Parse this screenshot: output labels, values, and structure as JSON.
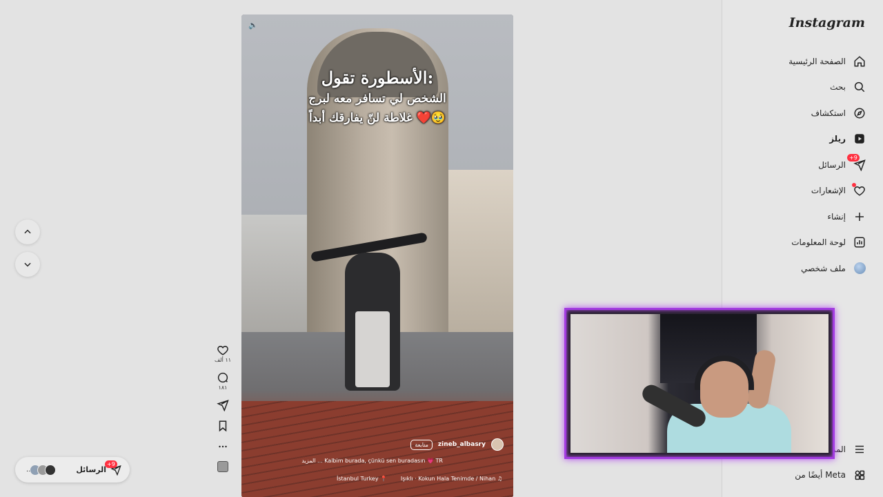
{
  "sidebar": {
    "logo": "Instagram",
    "items": [
      {
        "label": "الصفحة الرئيسية",
        "icon": "home-icon"
      },
      {
        "label": "بحث",
        "icon": "search-icon"
      },
      {
        "label": "استكشاف",
        "icon": "compass-icon"
      },
      {
        "label": "ريلز",
        "icon": "reels-icon"
      },
      {
        "label": "الرسائل",
        "icon": "messenger-icon",
        "badge": "+9"
      },
      {
        "label": "الإشعارات",
        "icon": "heart-icon"
      },
      {
        "label": "إنشاء",
        "icon": "plus-icon"
      },
      {
        "label": "لوحة المعلومات",
        "icon": "dashboard-icon"
      },
      {
        "label": "ملف شخصي",
        "icon": "profile-avatar"
      }
    ],
    "bottom": [
      {
        "label": "المزيد",
        "icon": "menu-icon"
      },
      {
        "label": "أيضًا من Meta",
        "icon": "meta-apps-icon"
      }
    ]
  },
  "reel": {
    "overlay_line1": "الأسطورة تقول:",
    "overlay_line2": "الشخص لي تسافر معه لبرج",
    "overlay_line3": "غلاطة لنّ يفارقك أبداً ❤️🥹",
    "username": "zineb_albasry",
    "follow_label": "متابعة",
    "caption": "Kalbim burada, çünkü sen buradasın 💗 TR ... المزيد",
    "audio": "Işıklı · Kokun Hala Tenimde / Nihan",
    "location": "İstanbul Turkey"
  },
  "actions": {
    "likes": "١١ ألف",
    "comments": "١٨١"
  },
  "messages_pill": {
    "label": "الرسائل",
    "badge": "+9",
    "more": "..."
  },
  "colors": {
    "accent_badge": "#ff3040",
    "webcam_border": "#a23be0"
  }
}
